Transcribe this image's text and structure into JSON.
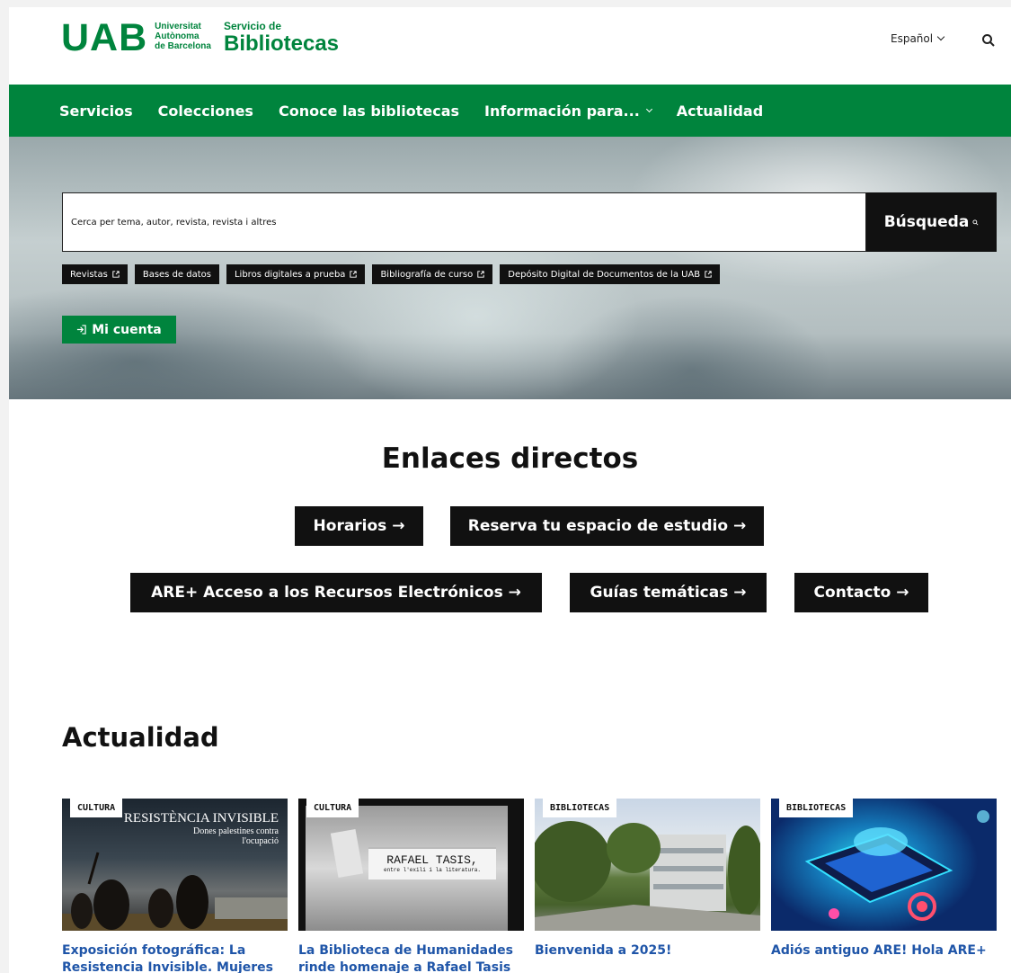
{
  "header": {
    "logo_uab": "UAB",
    "logo_university_lines": [
      "Universitat",
      "Autònoma",
      "de Barcelona"
    ],
    "service_small": "Servicio de",
    "service_big": "Bibliotecas",
    "language": "Español",
    "search_icon": "search-icon"
  },
  "nav": {
    "items": [
      "Servicios",
      "Colecciones",
      "Conoce las bibliotecas",
      "Información para...",
      "Actualidad"
    ]
  },
  "search": {
    "placeholder": "Cerca per tema, autor, revista, revista i altres",
    "button_label": "Búsqueda",
    "tags": [
      "Revistas",
      "Bases de datos",
      "Libros digitales a prueba",
      "Bibliografía de curso",
      "Depósito Digital de Documentos de la UAB"
    ],
    "account_label": "Mi cuenta"
  },
  "quick_links": {
    "title": "Enlaces directos",
    "items": [
      "Horarios →",
      "Reserva tu espacio de estudio →",
      "ARE+ Acceso a los Recursos Electrónicos →",
      "Guías temáticas →",
      "Contacto →"
    ]
  },
  "news": {
    "title": "Actualidad",
    "cards": [
      {
        "category": "CULTURA",
        "title": "Exposición fotográfica: La Resistencia Invisible. Mujeres",
        "image_text": [
          "RESISTÈNCIA INVISIBLE",
          "Dones palestines contra",
          "l'ocupació"
        ]
      },
      {
        "category": "CULTURA",
        "title": "La Biblioteca de Humanidades rinde homenaje a Rafael Tasis",
        "image_text": [
          "RAFAEL TASIS,",
          "entre l'exili i la literatura."
        ]
      },
      {
        "category": "BIBLIOTECAS",
        "title": "Bienvenida a 2025!"
      },
      {
        "category": "BIBLIOTECAS",
        "title": "Adiós antiguo ARE! Hola ARE+"
      }
    ]
  },
  "colors": {
    "brand_green": "#00843d",
    "dark": "#111111",
    "link_blue": "#1f55a8"
  }
}
